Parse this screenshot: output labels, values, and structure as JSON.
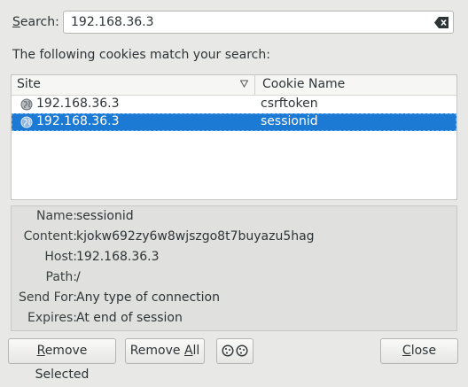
{
  "search": {
    "label_accesskey": "S",
    "label_rest": "earch:",
    "value": "192.168.36.3"
  },
  "intro_text": "The following cookies match your search:",
  "list": {
    "columns": {
      "site": "Site",
      "cookie_name": "Cookie Name"
    },
    "rows": [
      {
        "site": "192.168.36.3",
        "cookie_name": "csrftoken",
        "selected": false
      },
      {
        "site": "192.168.36.3",
        "cookie_name": "sessionid",
        "selected": true
      }
    ]
  },
  "details": [
    {
      "label": "Name:",
      "value": "sessionid"
    },
    {
      "label": "Content:",
      "value": "kjokw692zy6w8wjszgo8t7buyazu5hag"
    },
    {
      "label": "Host:",
      "value": "192.168.36.3"
    },
    {
      "label": "Path:",
      "value": "/"
    },
    {
      "label": "Send For:",
      "value": "Any type of connection"
    },
    {
      "label": "Expires:",
      "value": "At end of session"
    }
  ],
  "buttons": {
    "remove_selected": {
      "accesskey": "R",
      "rest": "emove Selected"
    },
    "remove_all": {
      "before": "Remove ",
      "accesskey": "A",
      "rest": "ll"
    },
    "exceptions_icon": "cookie-icon",
    "close": {
      "before": "",
      "accesskey": "C",
      "rest": "lose"
    }
  },
  "colors": {
    "selection": "#1c7ad4",
    "window_bg": "#e8e8e7"
  }
}
